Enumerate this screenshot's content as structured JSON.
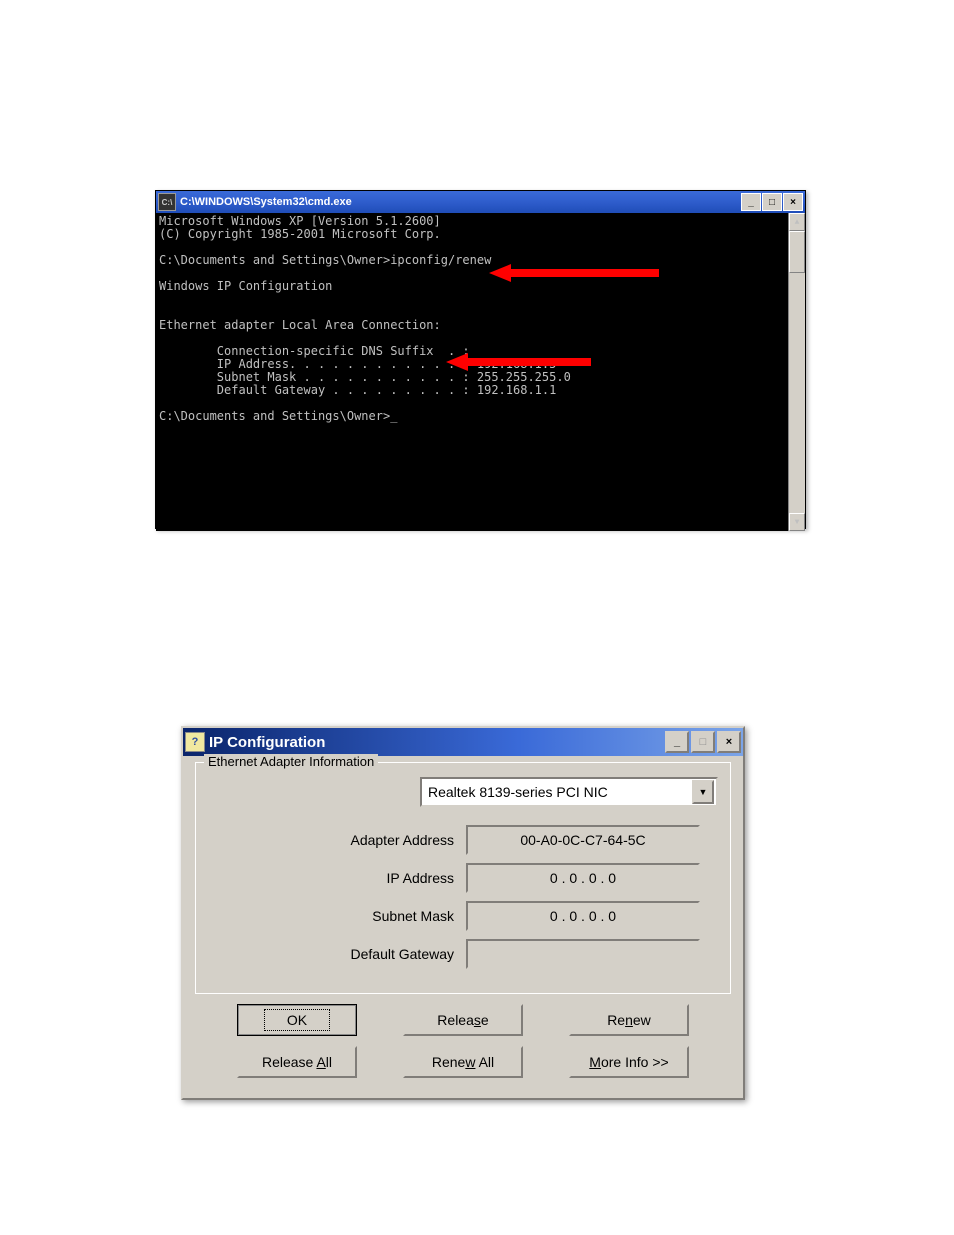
{
  "cmd": {
    "title_icon": "C:\\",
    "title": "C:\\WINDOWS\\System32\\cmd.exe",
    "line1": "Microsoft Windows XP [Version 5.1.2600]",
    "line2": "(C) Copyright 1985-2001 Microsoft Corp.",
    "prompt1": "C:\\Documents and Settings\\Owner>ipconfig/renew",
    "heading": "Windows IP Configuration",
    "adapter_title": "Ethernet adapter Local Area Connection:",
    "row_dns": "        Connection-specific DNS Suffix  . :",
    "row_ip": "        IP Address. . . . . . . . . . . . : 192.168.1.5",
    "row_mask": "        Subnet Mask . . . . . . . . . . . : 255.255.255.0",
    "row_gw": "        Default Gateway . . . . . . . . . : 192.168.1.1",
    "prompt2": "C:\\Documents and Settings\\Owner>_"
  },
  "ipconfig": {
    "title": "IP Configuration",
    "fieldset_legend": "Ethernet  Adapter Information",
    "adapter_selected": "Realtek 8139-series PCI NIC",
    "labels": {
      "adapter_address": "Adapter Address",
      "ip_address": "IP Address",
      "subnet_mask": "Subnet Mask",
      "default_gateway": "Default Gateway"
    },
    "values": {
      "adapter_address": "00-A0-0C-C7-64-5C",
      "ip_address": "0 . 0 . 0 . 0",
      "subnet_mask": "0 . 0 . 0 . 0",
      "default_gateway": ""
    },
    "buttons": {
      "ok": "OK",
      "release": "Release",
      "renew": "Renew",
      "release_all": "Release All",
      "renew_all": "Renew All",
      "more_info": "More Info >>"
    }
  },
  "winctrl": {
    "minimize": "_",
    "maximize": "□",
    "close": "×",
    "dropdown_arrow": "▼",
    "scroll_up": "▲",
    "scroll_down": "▼"
  }
}
